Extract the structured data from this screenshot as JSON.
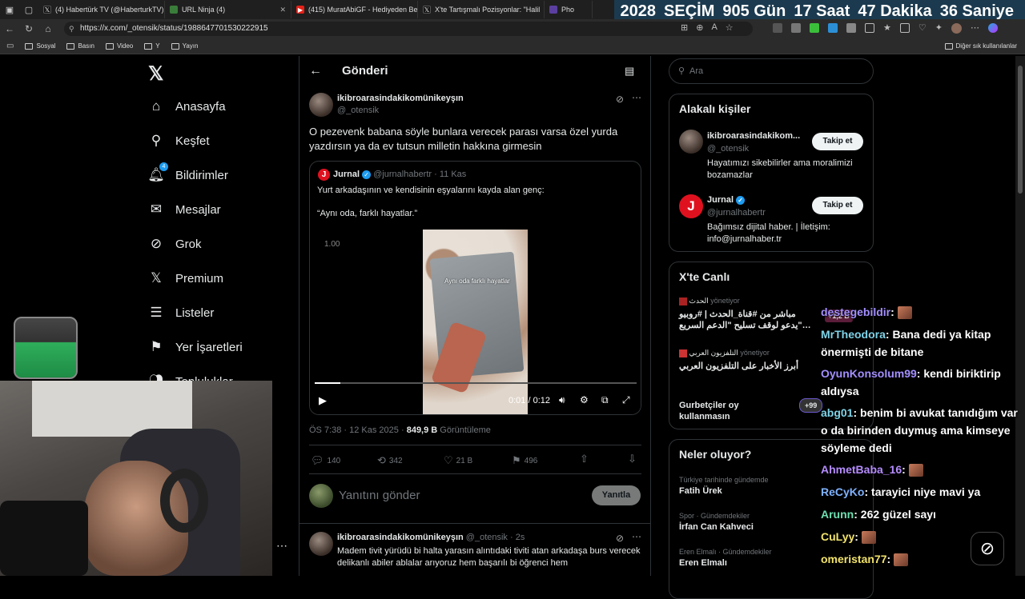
{
  "browser": {
    "tabs": [
      {
        "label": "(4) Habertürk TV (@HaberturkTV) /",
        "color": "#111"
      },
      {
        "label": "URL Ninja (4)",
        "color": "#3a7d3a"
      },
      {
        "label": "(415) MuratAbiGF - Hediyeden Be",
        "color": "#e62117"
      },
      {
        "label": "X'te Tartışmalı Pozisyonlar: \"Halil",
        "color": "#111"
      },
      {
        "label": "Pho",
        "color": "#5b3fa0"
      }
    ],
    "url": "https://x.com/_otensik/status/1988647701530222915",
    "bookmarks": [
      "Sosyal",
      "Basın",
      "Video",
      "Y",
      "Yayın"
    ],
    "bookmarks_other": "Diğer sık kullanılanlar"
  },
  "countdown": {
    "year": "2028",
    "title": "SEÇİM",
    "days": "905",
    "days_label": "Gün",
    "hours": "17",
    "hours_label": "Saat",
    "minutes": "47",
    "minutes_label": "Dakika",
    "seconds": "36",
    "seconds_label": "Saniye"
  },
  "nav": {
    "items": [
      "Anasayfa",
      "Keşfet",
      "Bildirimler",
      "Mesajlar",
      "Grok",
      "Premium",
      "Listeler",
      "Yer İşaretleri",
      "Topluluklar"
    ],
    "notif_count": "4"
  },
  "post_header": {
    "title": "Gönderi"
  },
  "post": {
    "author": "ikibroarasindakikomünikeyşın",
    "handle": "@_otensik",
    "text": "O pezevenk babana söyle bunlara verecek parası varsa özel yurda yazdırsın ya da ev tutsun milletin hakkına girmesin",
    "quote": {
      "author": "Jurnal",
      "handle": "@jurnalhabertr",
      "date": "· 11 Kas",
      "text1": "Yurt arkadaşının ve kendisinin eşyalarını kayda alan genç:",
      "text2": "“Aynı oda, farklı hayatlar.”",
      "video_speed": "1.00",
      "video_caption": "Aynı oda farklı hayatlar",
      "video_time": "0:01 / 0:12",
      "progress": 0.08
    },
    "meta_time": "ÖS 7:38 · 12 Kas 2025 ·",
    "views": "849,9 B",
    "views_label": "Görüntüleme",
    "stats": {
      "replies": "140",
      "reposts": "342",
      "likes": "21 B",
      "bookmarks": "496"
    },
    "reply_placeholder": "Yanıtını gönder",
    "reply_button": "Yanıtla"
  },
  "reply": {
    "author": "ikibroarasindakikomünikeyşın",
    "handle": "@_otensik",
    "time": "· 2s",
    "text": "Madem tivit yürüdü bi halta yarasın alıntıdaki tiviti atan arkadaşa burs verecek delikanlı abiler ablalar arıyoruz hem başarılı bi öğrenci hem"
  },
  "search": {
    "placeholder": "Ara"
  },
  "related": {
    "title": "Alakalı kişiler",
    "people": [
      {
        "name": "ikibroarasindakikom...",
        "handle": "@_otensik",
        "bio": "Hayatımızı sikebilirler ama moralimizi bozamazlar",
        "button": "Takip et"
      },
      {
        "name": "Jurnal",
        "handle": "@jurnalhabertr",
        "bio": "Bağımsız dijital haber. | İletişim: info@jurnalhaber.tr",
        "button": "Takip et"
      }
    ]
  },
  "live": {
    "title": "X'te Canlı",
    "items": [
      {
        "host": "الحدث",
        "role": "yönetiyor",
        "text": "مباشر من #قناة_الحدث | #روبيو \"يدعو لوقف تسليح \"الدعم السريع…",
        "count": "+1,2 B"
      },
      {
        "host": "التلفزيون العربي",
        "role": "yönetiyor",
        "text": "أبرز الأخبار على التلفزيون العربي"
      },
      {
        "host": "",
        "role": "",
        "text": "Gurbetçiler oy kullanmasın",
        "count": "+99"
      }
    ]
  },
  "trends": {
    "title": "Neler oluyor?",
    "items": [
      {
        "context": "Türkiye tarihinde gündemde",
        "name": "Fatih Ürek"
      },
      {
        "context": "Spor · Gündemdekiler",
        "name": "İrfan Can Kahveci"
      },
      {
        "context": "Eren Elmalı · Gündemdekiler",
        "name": "Eren Elmalı"
      }
    ]
  },
  "chat": [
    {
      "user": "destegebildir",
      "color": "#a48fff",
      "msg": "",
      "emote": true
    },
    {
      "user": "MrTheodora",
      "color": "#7fd3e8",
      "msg": "Bana dedi ya kitap önermişti de bitane"
    },
    {
      "user": "OyunKonsolum99",
      "color": "#a48fff",
      "msg": "kendi biriktirip aldıysa"
    },
    {
      "user": "abg01",
      "color": "#7fd3e8",
      "msg": "benim bi avukat tanıdığım var o da birinden duymuş ama kimseye söyleme dedi"
    },
    {
      "user": "AhmetBaba_16",
      "color": "#b58cff",
      "msg": "",
      "emote": true
    },
    {
      "user": "ReCyKo",
      "color": "#7fb2ff",
      "msg": "tarayici niye mavi ya"
    },
    {
      "user": "Arunn",
      "color": "#6ee0b0",
      "msg": "262 güzel sayı"
    },
    {
      "user": "CuLyy",
      "color": "#f2e36b",
      "msg": "",
      "emote": true
    },
    {
      "user": "omeristan77",
      "color": "#f2e36b",
      "msg": "",
      "emote": true
    }
  ]
}
